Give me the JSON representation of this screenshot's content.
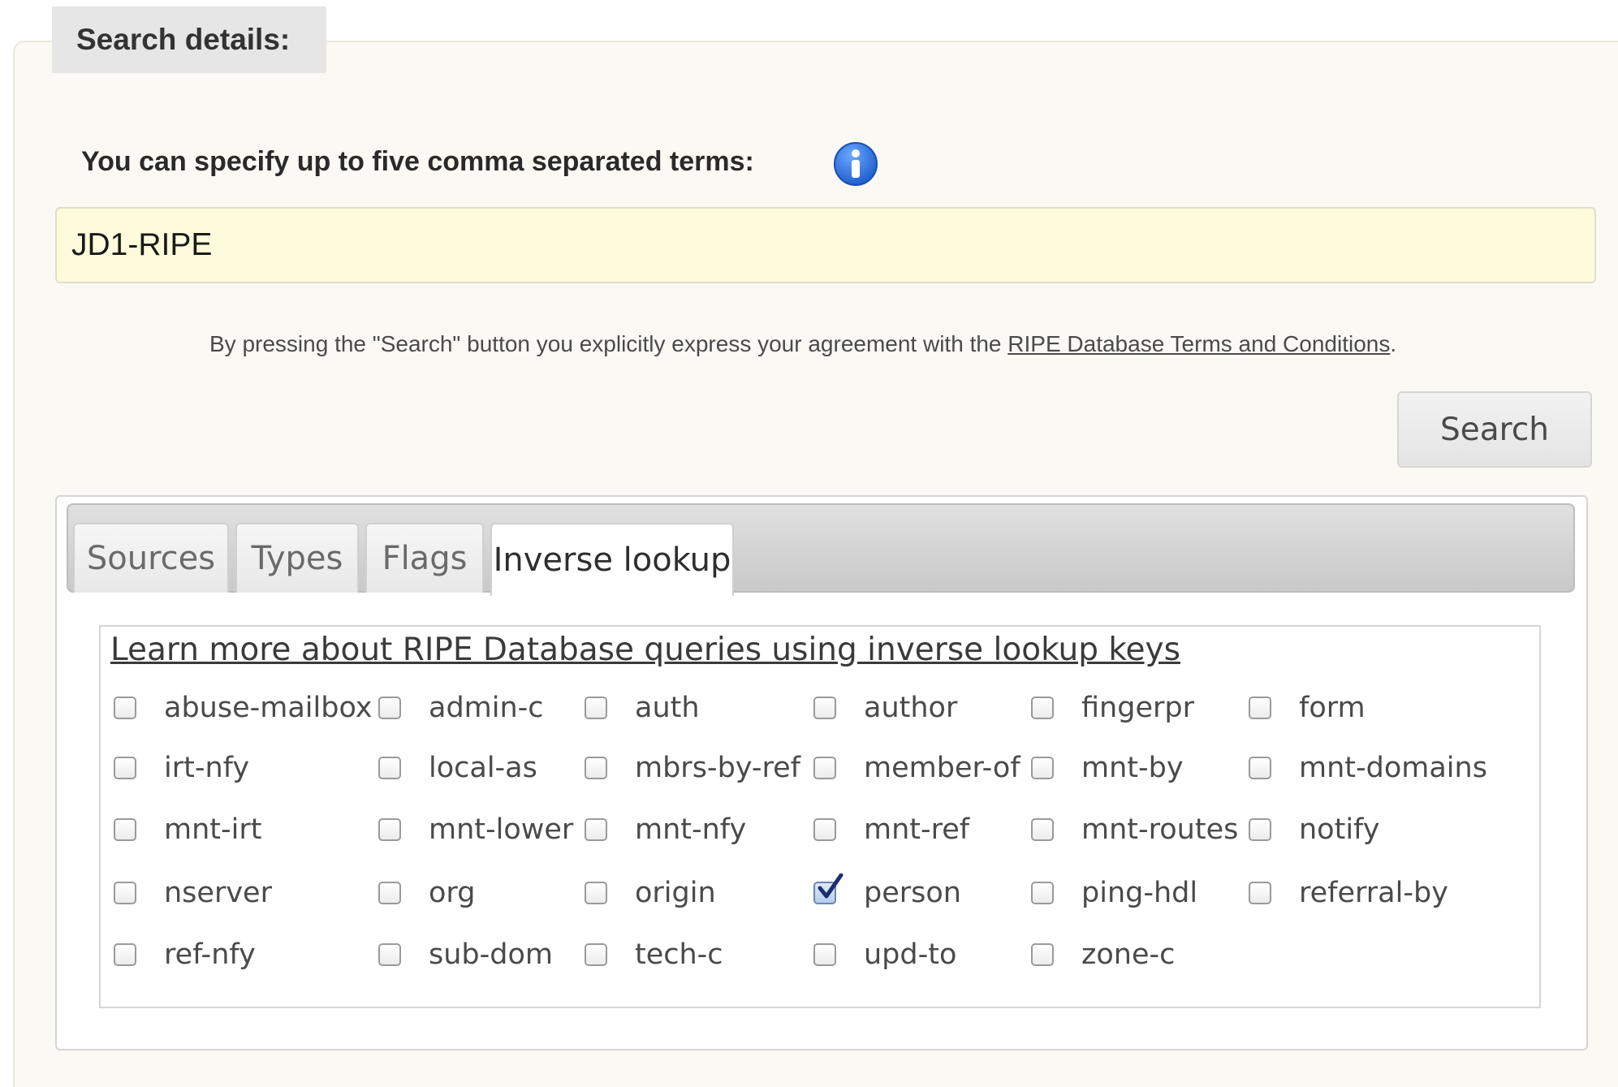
{
  "legend": "Search details:",
  "terms_label": "You can specify up to five comma separated terms:",
  "search": {
    "value": "JD1-RIPE"
  },
  "agreement": {
    "prefix": "By pressing the \"Search\" button you explicitly express your agreement with the ",
    "link": "RIPE Database Terms and Conditions",
    "suffix": "."
  },
  "search_button": "Search",
  "tabs": [
    {
      "label": "Sources",
      "active": false
    },
    {
      "label": "Types",
      "active": false
    },
    {
      "label": "Flags",
      "active": false
    },
    {
      "label": "Inverse lookup",
      "active": true
    }
  ],
  "inverse_lookup": {
    "learn_more": "Learn more about RIPE Database queries using inverse lookup keys",
    "options": [
      {
        "label": "abuse-mailbox",
        "checked": false
      },
      {
        "label": "admin-c",
        "checked": false
      },
      {
        "label": "auth",
        "checked": false
      },
      {
        "label": "author",
        "checked": false
      },
      {
        "label": "fingerpr",
        "checked": false
      },
      {
        "label": "form",
        "checked": false
      },
      {
        "label": "irt-nfy",
        "checked": false
      },
      {
        "label": "local-as",
        "checked": false
      },
      {
        "label": "mbrs-by-ref",
        "checked": false
      },
      {
        "label": "member-of",
        "checked": false
      },
      {
        "label": "mnt-by",
        "checked": false
      },
      {
        "label": "mnt-domains",
        "checked": false
      },
      {
        "label": "mnt-irt",
        "checked": false
      },
      {
        "label": "mnt-lower",
        "checked": false
      },
      {
        "label": "mnt-nfy",
        "checked": false
      },
      {
        "label": "mnt-ref",
        "checked": false
      },
      {
        "label": "mnt-routes",
        "checked": false
      },
      {
        "label": "notify",
        "checked": false
      },
      {
        "label": "nserver",
        "checked": false
      },
      {
        "label": "org",
        "checked": false
      },
      {
        "label": "origin",
        "checked": false
      },
      {
        "label": "person",
        "checked": true
      },
      {
        "label": "ping-hdl",
        "checked": false
      },
      {
        "label": "referral-by",
        "checked": false
      },
      {
        "label": "ref-nfy",
        "checked": false
      },
      {
        "label": "sub-dom",
        "checked": false
      },
      {
        "label": "tech-c",
        "checked": false
      },
      {
        "label": "upd-to",
        "checked": false
      },
      {
        "label": "zone-c",
        "checked": false
      }
    ]
  },
  "icons": {
    "info": "info-icon",
    "checkmark": "checkmark-icon"
  },
  "colors": {
    "info_blue": "#1f6fe0",
    "input_bg": "#fdfbdc",
    "panel_bg": "#faf9f3"
  }
}
